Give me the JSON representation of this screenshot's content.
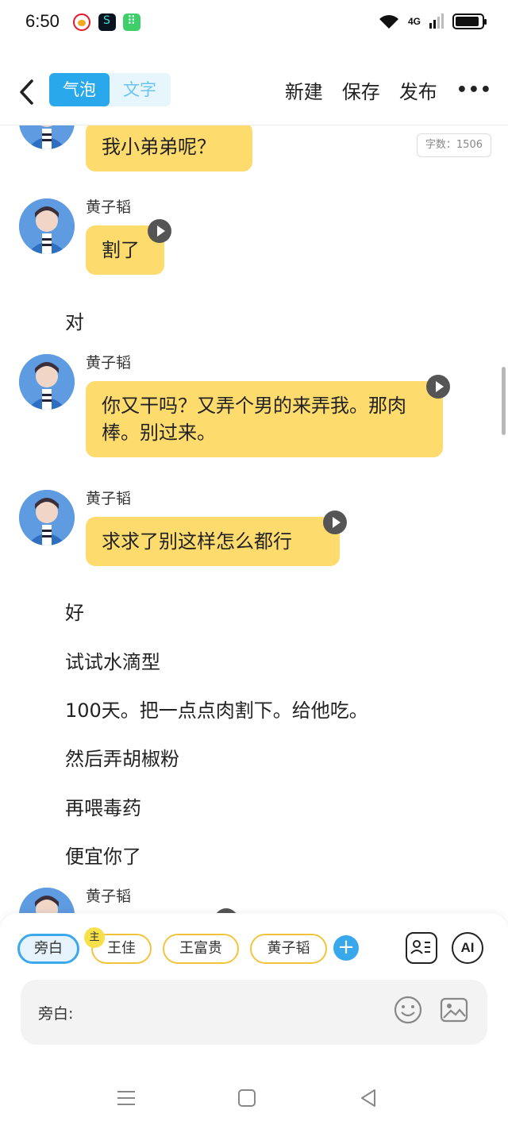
{
  "status_bar": {
    "time": "6:50",
    "network": "4G"
  },
  "top_nav": {
    "segments": [
      "气泡",
      "文字"
    ],
    "active_segment": "气泡",
    "actions": [
      "新建",
      "保存",
      "发布"
    ],
    "more": "•••"
  },
  "word_count": "字数：1506",
  "messages": {
    "m0": {
      "text": "我小弟弟呢？"
    },
    "m1": {
      "sender": "黄子韬",
      "text": "割了"
    },
    "n1": "对",
    "m2": {
      "sender": "黄子韬",
      "text": "你又干吗？又弄个男的来弄我。那肉棒。别过来。"
    },
    "m3": {
      "sender": "黄子韬",
      "text": "求求了别这样怎么都行"
    },
    "narration": [
      "好",
      "试试水滴型",
      "100天。把一点点肉割下。给他吃。",
      "然后弄胡椒粉",
      "再喂毒药",
      "便宜你了"
    ],
    "m4": {
      "sender": "黄子韬"
    }
  },
  "composer": {
    "roles": [
      "旁白",
      "王佳",
      "王富贵",
      "黄子韬"
    ],
    "selected_role": "旁白",
    "main_badge": "主",
    "add": "+",
    "ai": "AI",
    "input_label": "旁白:"
  },
  "colors": {
    "bubble": "#fedb6d",
    "accent": "#29a8eb",
    "chip_border": "#f2c43e"
  }
}
